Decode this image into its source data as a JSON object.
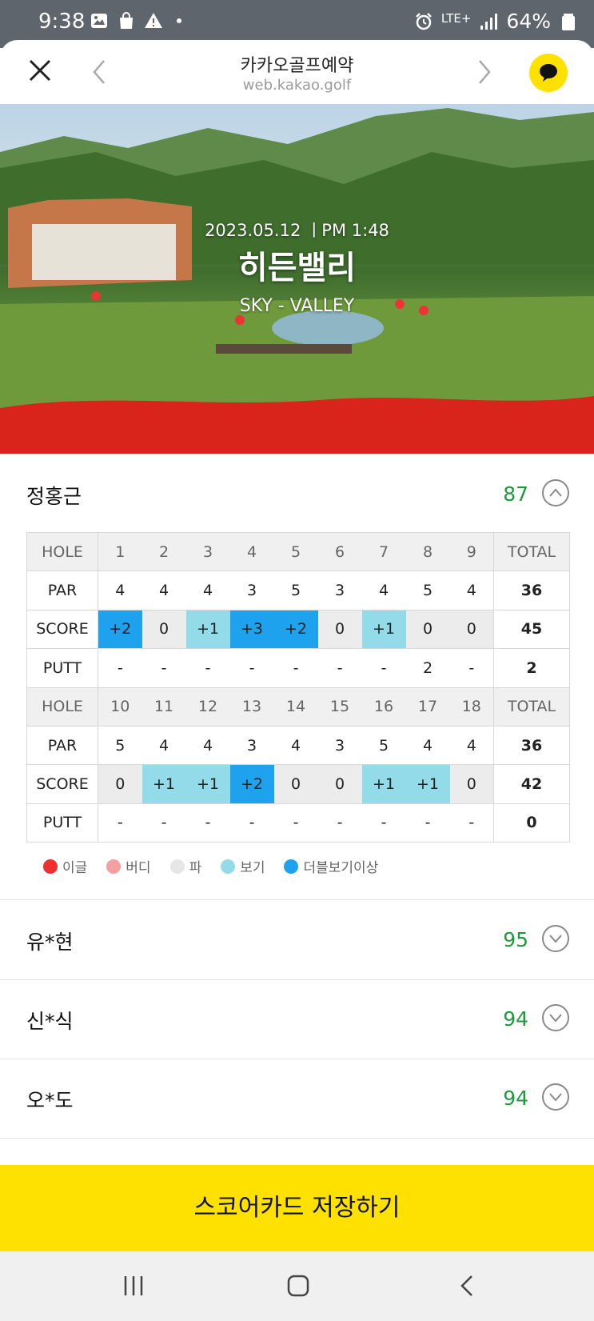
{
  "status_bar": {
    "time": "9:38",
    "network": "LTE+",
    "battery": "64%"
  },
  "header": {
    "title": "카카오골프예약",
    "url": "web.kakao.golf"
  },
  "hero": {
    "date": "2023.05.12 ㅣPM 1:48",
    "course_name": "히든밸리",
    "course_sub": "SKY - VALLEY"
  },
  "expanded_player": {
    "name": "정홍근",
    "total": "87"
  },
  "scorecard": {
    "front": {
      "hole_label": "HOLE",
      "holes": [
        "1",
        "2",
        "3",
        "4",
        "5",
        "6",
        "7",
        "8",
        "9"
      ],
      "total_label": "TOTAL",
      "par_label": "PAR",
      "par": [
        "4",
        "4",
        "4",
        "3",
        "5",
        "3",
        "4",
        "5",
        "4"
      ],
      "par_total": "36",
      "score_label": "SCORE",
      "score": [
        "+2",
        "0",
        "+1",
        "+3",
        "+2",
        "0",
        "+1",
        "0",
        "0"
      ],
      "score_total": "45",
      "putt_label": "PUTT",
      "putt": [
        "-",
        "-",
        "-",
        "-",
        "-",
        "-",
        "-",
        "2",
        "-"
      ],
      "putt_total": "2"
    },
    "back": {
      "hole_label": "HOLE",
      "holes": [
        "10",
        "11",
        "12",
        "13",
        "14",
        "15",
        "16",
        "17",
        "18"
      ],
      "total_label": "TOTAL",
      "par_label": "PAR",
      "par": [
        "5",
        "4",
        "4",
        "3",
        "4",
        "3",
        "5",
        "4",
        "4"
      ],
      "par_total": "36",
      "score_label": "SCORE",
      "score": [
        "0",
        "+1",
        "+1",
        "+2",
        "0",
        "0",
        "+1",
        "+1",
        "0"
      ],
      "score_total": "42",
      "putt_label": "PUTT",
      "putt": [
        "-",
        "-",
        "-",
        "-",
        "-",
        "-",
        "-",
        "-",
        "-"
      ],
      "putt_total": "0"
    }
  },
  "legend": [
    {
      "label": "이글",
      "color": "#ef3030"
    },
    {
      "label": "버디",
      "color": "#f5a0a0"
    },
    {
      "label": "파",
      "color": "#e6e6e6"
    },
    {
      "label": "보기",
      "color": "#93dbe8"
    },
    {
      "label": "더블보기이상",
      "color": "#1ea2ee"
    }
  ],
  "other_players": [
    {
      "name": "유*현",
      "total": "95"
    },
    {
      "name": "신*식",
      "total": "94"
    },
    {
      "name": "오*도",
      "total": "94"
    }
  ],
  "save_button": "스코어카드 저장하기",
  "colors": {
    "accent_yellow": "#ffe100",
    "score_green": "#1e9a3d",
    "double_bogey": "#1ea2ee",
    "bogey": "#93dbe8",
    "par": "#ececec"
  }
}
